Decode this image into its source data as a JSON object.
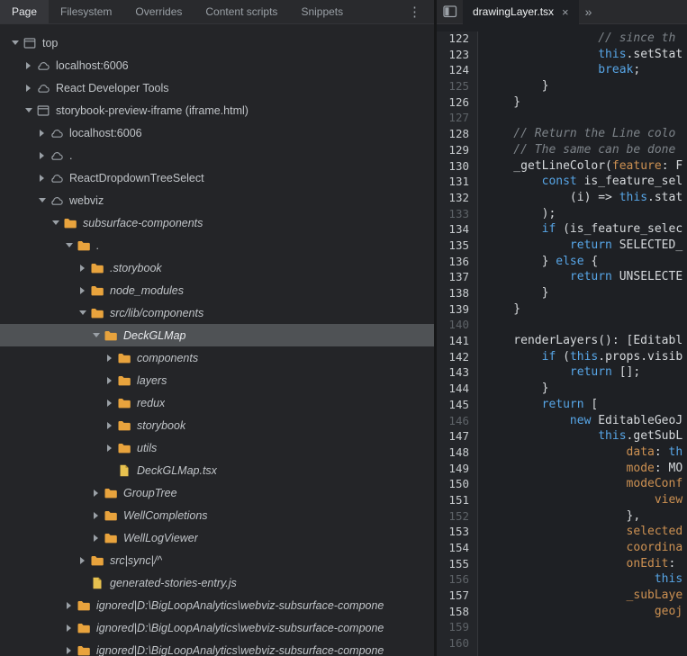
{
  "colors": {
    "chrome_bar": "#292a2d",
    "tree_bg": "#242528",
    "editor_bg": "#1e2024",
    "selection_bg": "#4f5255",
    "folder_icon": "#e8a33d",
    "file_icon": "#e7c14f",
    "keyword": "#57a5e6",
    "property": "#cd9152",
    "comment": "#7d8389",
    "inactive_text": "#9aa0a6",
    "active_text": "#e8eaed"
  },
  "left_tabbar": {
    "tabs": [
      {
        "label": "Page",
        "active": true
      },
      {
        "label": "Filesystem",
        "active": false
      },
      {
        "label": "Overrides",
        "active": false
      },
      {
        "label": "Content scripts",
        "active": false
      },
      {
        "label": "Snippets",
        "active": false
      }
    ],
    "more_button": "⋮"
  },
  "editor_tabbar": {
    "tab": {
      "label": "drawingLayer.tsx",
      "close": "×"
    },
    "overflow": "»"
  },
  "tree": {
    "items": [
      {
        "depth": 0,
        "arrow": "open",
        "icon": "frame",
        "label": "top"
      },
      {
        "depth": 1,
        "arrow": "closed",
        "icon": "cloud",
        "label": "localhost:6006"
      },
      {
        "depth": 1,
        "arrow": "closed",
        "icon": "cloud",
        "label": "React Developer Tools"
      },
      {
        "depth": 1,
        "arrow": "open",
        "icon": "frame",
        "label": "storybook-preview-iframe (iframe.html)"
      },
      {
        "depth": 2,
        "arrow": "closed",
        "icon": "cloud",
        "label": "localhost:6006"
      },
      {
        "depth": 2,
        "arrow": "closed",
        "icon": "cloud",
        "label": "."
      },
      {
        "depth": 2,
        "arrow": "closed",
        "icon": "cloud",
        "label": "ReactDropdownTreeSelect"
      },
      {
        "depth": 2,
        "arrow": "open",
        "icon": "cloud",
        "label": "webviz"
      },
      {
        "depth": 3,
        "arrow": "open",
        "icon": "folder",
        "label": "subsurface-components",
        "italic": true
      },
      {
        "depth": 4,
        "arrow": "open",
        "icon": "folder",
        "label": ".",
        "italic": true
      },
      {
        "depth": 5,
        "arrow": "closed",
        "icon": "folder",
        "label": ".storybook",
        "italic": true
      },
      {
        "depth": 5,
        "arrow": "closed",
        "icon": "folder",
        "label": "node_modules",
        "italic": true
      },
      {
        "depth": 5,
        "arrow": "open",
        "icon": "folder",
        "label": "src/lib/components",
        "italic": true
      },
      {
        "depth": 6,
        "arrow": "open",
        "icon": "folder",
        "label": "DeckGLMap",
        "italic": true,
        "selected": true
      },
      {
        "depth": 7,
        "arrow": "closed",
        "icon": "folder",
        "label": "components",
        "italic": true
      },
      {
        "depth": 7,
        "arrow": "closed",
        "icon": "folder",
        "label": "layers",
        "italic": true
      },
      {
        "depth": 7,
        "arrow": "closed",
        "icon": "folder",
        "label": "redux",
        "italic": true
      },
      {
        "depth": 7,
        "arrow": "closed",
        "icon": "folder",
        "label": "storybook",
        "italic": true
      },
      {
        "depth": 7,
        "arrow": "closed",
        "icon": "folder",
        "label": "utils",
        "italic": true
      },
      {
        "depth": 7,
        "arrow": "none",
        "icon": "file",
        "label": "DeckGLMap.tsx",
        "italic": true
      },
      {
        "depth": 6,
        "arrow": "closed",
        "icon": "folder",
        "label": "GroupTree",
        "italic": true
      },
      {
        "depth": 6,
        "arrow": "closed",
        "icon": "folder",
        "label": "WellCompletions",
        "italic": true
      },
      {
        "depth": 6,
        "arrow": "closed",
        "icon": "folder",
        "label": "WellLogViewer",
        "italic": true
      },
      {
        "depth": 5,
        "arrow": "closed",
        "icon": "folder",
        "label": "src|sync|/^",
        "italic": true
      },
      {
        "depth": 5,
        "arrow": "none",
        "icon": "file",
        "label": "generated-stories-entry.js",
        "italic": true
      },
      {
        "depth": 4,
        "arrow": "closed",
        "icon": "folder",
        "label": "ignored|D:\\BigLoopAnalytics\\webviz-subsurface-compone",
        "italic": true
      },
      {
        "depth": 4,
        "arrow": "closed",
        "icon": "folder",
        "label": "ignored|D:\\BigLoopAnalytics\\webviz-subsurface-compone",
        "italic": true
      },
      {
        "depth": 4,
        "arrow": "closed",
        "icon": "folder",
        "label": "ignored|D:\\BigLoopAnalytics\\webviz-subsurface-compone",
        "italic": true
      }
    ]
  },
  "code": {
    "lines": [
      {
        "n": 122,
        "dim": false,
        "t": [
          [
            "c",
            "                // since th"
          ]
        ]
      },
      {
        "n": 123,
        "dim": false,
        "t": [
          [
            "p",
            "                "
          ],
          [
            "k",
            "this"
          ],
          [
            "p",
            ".setStat"
          ]
        ]
      },
      {
        "n": 124,
        "dim": false,
        "t": [
          [
            "p",
            "                "
          ],
          [
            "k",
            "break"
          ],
          [
            "p",
            ";"
          ]
        ]
      },
      {
        "n": 125,
        "dim": true,
        "t": [
          [
            "p",
            "        }"
          ]
        ]
      },
      {
        "n": 126,
        "dim": false,
        "t": [
          [
            "p",
            "    }"
          ]
        ]
      },
      {
        "n": 127,
        "dim": true,
        "t": []
      },
      {
        "n": 128,
        "dim": false,
        "t": [
          [
            "c",
            "    // Return the Line colo"
          ]
        ]
      },
      {
        "n": 129,
        "dim": false,
        "t": [
          [
            "c",
            "    // The same can be done"
          ]
        ]
      },
      {
        "n": 130,
        "dim": false,
        "t": [
          [
            "p",
            "    _getLineColor("
          ],
          [
            "o",
            "feature"
          ],
          [
            "p",
            ": F"
          ]
        ]
      },
      {
        "n": 131,
        "dim": false,
        "t": [
          [
            "p",
            "        "
          ],
          [
            "k",
            "const"
          ],
          [
            "p",
            " is_feature_sel"
          ]
        ]
      },
      {
        "n": 132,
        "dim": false,
        "t": [
          [
            "p",
            "            (i) => "
          ],
          [
            "k",
            "this"
          ],
          [
            "p",
            ".stat"
          ]
        ]
      },
      {
        "n": 133,
        "dim": true,
        "t": [
          [
            "p",
            "        );"
          ]
        ]
      },
      {
        "n": 134,
        "dim": false,
        "t": [
          [
            "p",
            "        "
          ],
          [
            "k",
            "if"
          ],
          [
            "p",
            " (is_feature_selec"
          ]
        ]
      },
      {
        "n": 135,
        "dim": false,
        "t": [
          [
            "p",
            "            "
          ],
          [
            "k",
            "return"
          ],
          [
            "p",
            " SELECTED_"
          ]
        ]
      },
      {
        "n": 136,
        "dim": false,
        "t": [
          [
            "p",
            "        } "
          ],
          [
            "k",
            "else"
          ],
          [
            "p",
            " {"
          ]
        ]
      },
      {
        "n": 137,
        "dim": false,
        "t": [
          [
            "p",
            "            "
          ],
          [
            "k",
            "return"
          ],
          [
            "p",
            " UNSELECTE"
          ]
        ]
      },
      {
        "n": 138,
        "dim": false,
        "t": [
          [
            "p",
            "        }"
          ]
        ]
      },
      {
        "n": 139,
        "dim": false,
        "t": [
          [
            "p",
            "    }"
          ]
        ]
      },
      {
        "n": 140,
        "dim": true,
        "t": []
      },
      {
        "n": 141,
        "dim": false,
        "t": [
          [
            "p",
            "    renderLayers(): [Editabl"
          ]
        ]
      },
      {
        "n": 142,
        "dim": false,
        "t": [
          [
            "p",
            "        "
          ],
          [
            "k",
            "if"
          ],
          [
            "p",
            " ("
          ],
          [
            "k",
            "this"
          ],
          [
            "p",
            ".props.visib"
          ]
        ]
      },
      {
        "n": 143,
        "dim": false,
        "t": [
          [
            "p",
            "            "
          ],
          [
            "k",
            "return"
          ],
          [
            "p",
            " [];"
          ]
        ]
      },
      {
        "n": 144,
        "dim": false,
        "t": [
          [
            "p",
            "        }"
          ]
        ]
      },
      {
        "n": 145,
        "dim": false,
        "t": [
          [
            "p",
            "        "
          ],
          [
            "k",
            "return"
          ],
          [
            "p",
            " ["
          ]
        ]
      },
      {
        "n": 146,
        "dim": true,
        "t": [
          [
            "p",
            "            "
          ],
          [
            "k",
            "new"
          ],
          [
            "p",
            " EditableGeoJ"
          ]
        ]
      },
      {
        "n": 147,
        "dim": false,
        "t": [
          [
            "p",
            "                "
          ],
          [
            "k",
            "this"
          ],
          [
            "p",
            ".getSubL"
          ]
        ]
      },
      {
        "n": 148,
        "dim": false,
        "t": [
          [
            "p",
            "                    "
          ],
          [
            "o",
            "data"
          ],
          [
            "p",
            ": "
          ],
          [
            "k",
            "th"
          ]
        ]
      },
      {
        "n": 149,
        "dim": false,
        "t": [
          [
            "p",
            "                    "
          ],
          [
            "o",
            "mode"
          ],
          [
            "p",
            ": MO"
          ]
        ]
      },
      {
        "n": 150,
        "dim": false,
        "t": [
          [
            "p",
            "                    "
          ],
          [
            "o",
            "modeConf"
          ]
        ]
      },
      {
        "n": 151,
        "dim": false,
        "t": [
          [
            "p",
            "                        "
          ],
          [
            "o",
            "view"
          ]
        ]
      },
      {
        "n": 152,
        "dim": true,
        "t": [
          [
            "p",
            "                    },"
          ]
        ]
      },
      {
        "n": 153,
        "dim": false,
        "t": [
          [
            "p",
            "                    "
          ],
          [
            "o",
            "selected"
          ]
        ]
      },
      {
        "n": 154,
        "dim": false,
        "t": [
          [
            "p",
            "                    "
          ],
          [
            "o",
            "coordina"
          ]
        ]
      },
      {
        "n": 155,
        "dim": false,
        "t": [
          [
            "p",
            "                    "
          ],
          [
            "o",
            "onEdit"
          ],
          [
            "p",
            ": "
          ]
        ]
      },
      {
        "n": 156,
        "dim": true,
        "t": [
          [
            "p",
            "                        "
          ],
          [
            "k",
            "this"
          ]
        ]
      },
      {
        "n": 157,
        "dim": false,
        "t": [
          [
            "p",
            "                    "
          ],
          [
            "o",
            "_subLaye"
          ]
        ]
      },
      {
        "n": 158,
        "dim": false,
        "t": [
          [
            "p",
            "                        "
          ],
          [
            "o",
            "geoj"
          ]
        ]
      },
      {
        "n": 159,
        "dim": true,
        "t": []
      },
      {
        "n": 160,
        "dim": true,
        "t": []
      }
    ]
  }
}
